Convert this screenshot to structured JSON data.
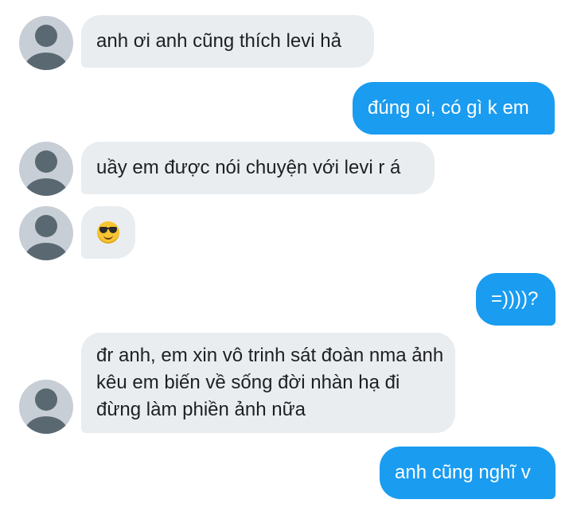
{
  "conversation": {
    "messages": [
      {
        "sender": "other",
        "text": "anh ơi anh cũng thích levi hả"
      },
      {
        "sender": "me",
        "text": "đúng oi, có gì k em"
      },
      {
        "sender": "other",
        "text": "uầy em được nói chuyện với levi r á"
      },
      {
        "sender": "other",
        "emoji": "smiling-face-with-sunglasses"
      },
      {
        "sender": "me",
        "text": "=))))?"
      },
      {
        "sender": "other",
        "text": "đr anh, em xin vô trinh sát đoàn nma ảnh kêu em biến về sống đời nhàn hạ đi đừng làm phiền ảnh nữa"
      },
      {
        "sender": "me",
        "text": "anh cũng nghĩ v"
      }
    ]
  },
  "colors": {
    "incoming_bubble": "#e9edf0",
    "outgoing_bubble": "#1a9cf0",
    "avatar_bg": "#c7ced5",
    "avatar_fg": "#5a6872"
  }
}
